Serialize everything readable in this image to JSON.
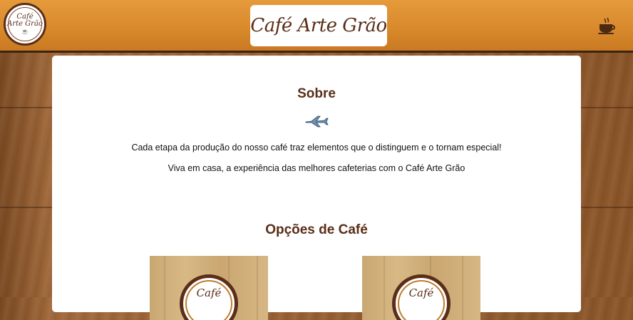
{
  "header": {
    "logo": {
      "line1": "Café",
      "line2": "Arte Grão"
    },
    "title": "Café Arte Grão",
    "cup_icon": "coffee-cup-icon"
  },
  "about": {
    "heading": "Sobre",
    "icon": "airplane-icon",
    "paragraphs": [
      "Cada etapa da produção do nosso café traz elementos que o distinguem e o tornam especial!",
      "Viva em casa, a experiência das melhores cafeterias com o Café Arte Grão"
    ]
  },
  "options": {
    "heading": "Opções de Café",
    "products": [
      {
        "badge_text": "Café"
      },
      {
        "badge_text": "Café"
      }
    ]
  },
  "colors": {
    "header": "#d98a2c",
    "brown": "#5a2e18",
    "panel": "#ffffff"
  }
}
